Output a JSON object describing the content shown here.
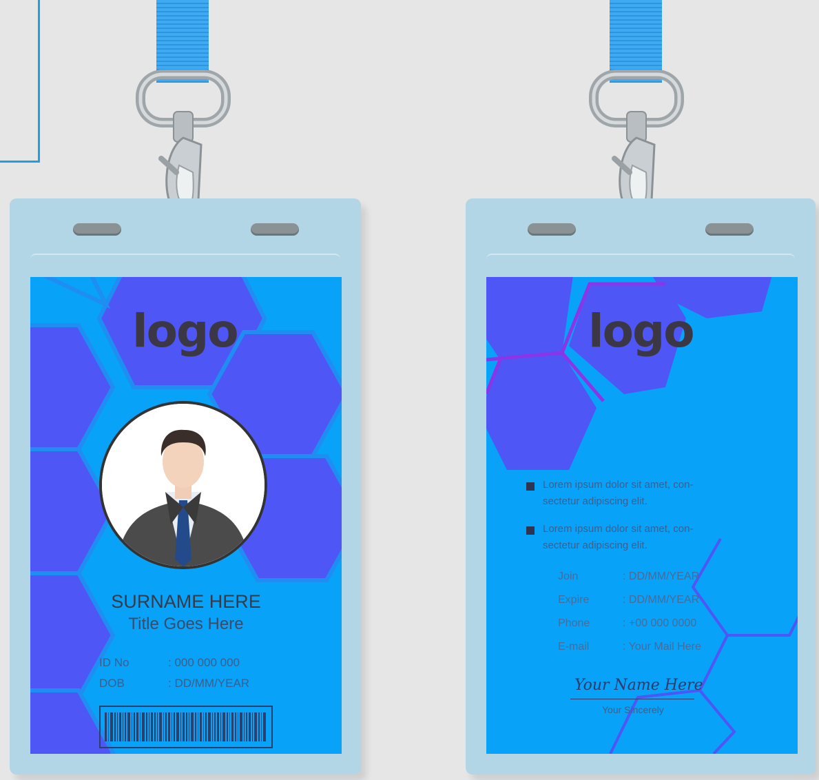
{
  "front": {
    "logo": "logo",
    "surname": "SURNAME HERE",
    "title": "Title Goes Here",
    "fields": [
      {
        "label": "ID No",
        "value": ": 000 000 000"
      },
      {
        "label": "DOB",
        "value": ": DD/MM/YEAR"
      }
    ]
  },
  "back": {
    "logo": "logo",
    "bullets": [
      {
        "line1": "Lorem ipsum dolor sit amet, con-",
        "line2": "sectetur adipiscing elit."
      },
      {
        "line1": "Lorem ipsum dolor sit amet, con-",
        "line2": "sectetur adipiscing elit."
      }
    ],
    "fields": [
      {
        "label": "Join",
        "value": ": DD/MM/YEAR"
      },
      {
        "label": "Expire",
        "value": ": DD/MM/YEAR"
      },
      {
        "label": "Phone",
        "value": ": +00 000 0000"
      },
      {
        "label": "E-mail",
        "value": ": Your Mail Here"
      }
    ],
    "signature": "Your Name Here",
    "signature_label": "Your Sincerely"
  },
  "colors": {
    "card_blue": "#08a2f8",
    "hex_purple": "#4e56f5",
    "hex_border": "#1f8df2",
    "holder": "#b2d6e6",
    "strap": "#3fa9f2"
  },
  "icons": [
    "person-avatar-icon",
    "barcode-icon",
    "lanyard-clip-icon"
  ]
}
